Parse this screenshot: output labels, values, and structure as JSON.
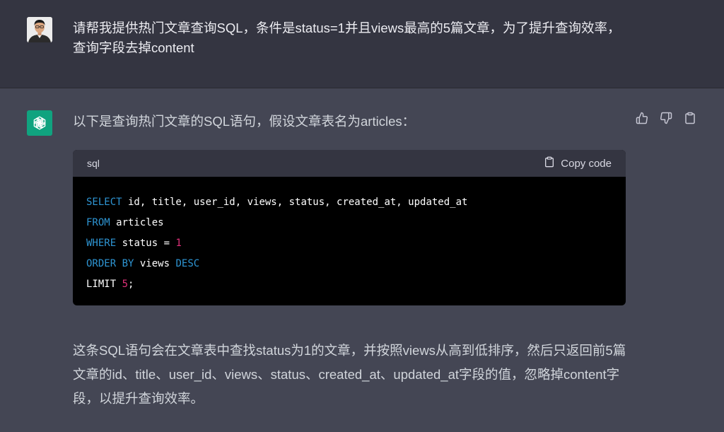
{
  "user_message": {
    "text": "请帮我提供热门文章查询SQL，条件是status=1并且views最高的5篇文章，为了提升查询效率，查询字段去掉content"
  },
  "assistant_message": {
    "intro": "以下是查询热门文章的SQL语句，假设文章表名为articles：",
    "code_block": {
      "language": "sql",
      "copy_label": "Copy code",
      "lines": [
        [
          {
            "t": "SELECT",
            "c": "kw"
          },
          {
            "t": " id, title, user_id, views, status, created_at, updated_at",
            "c": ""
          }
        ],
        [
          {
            "t": "FROM",
            "c": "kw"
          },
          {
            "t": " articles",
            "c": ""
          }
        ],
        [
          {
            "t": "WHERE",
            "c": "kw"
          },
          {
            "t": " status ",
            "c": ""
          },
          {
            "t": "=",
            "c": ""
          },
          {
            "t": " ",
            "c": ""
          },
          {
            "t": "1",
            "c": "num"
          }
        ],
        [
          {
            "t": "ORDER",
            "c": "kw"
          },
          {
            "t": " ",
            "c": ""
          },
          {
            "t": "BY",
            "c": "kw"
          },
          {
            "t": " views ",
            "c": ""
          },
          {
            "t": "DESC",
            "c": "kw"
          }
        ],
        [
          {
            "t": "LIMIT",
            "c": ""
          },
          {
            "t": " ",
            "c": ""
          },
          {
            "t": "5",
            "c": "num"
          },
          {
            "t": ";",
            "c": ""
          }
        ]
      ]
    },
    "summary": "这条SQL语句会在文章表中查找status为1的文章，并按照views从高到低排序，然后只返回前5篇文章的id、title、user_id、views、status、created_at、updated_at字段的值，忽略掉content字段，以提升查询效率。"
  },
  "icons": {
    "thumbs_up": "thumbs-up-icon",
    "thumbs_down": "thumbs-down-icon",
    "copy": "clipboard-icon"
  },
  "colors": {
    "user_bg": "#343541",
    "assistant_bg": "#444654",
    "brand": "#10a37f",
    "keyword": "#2e95d3",
    "number": "#df3079"
  }
}
